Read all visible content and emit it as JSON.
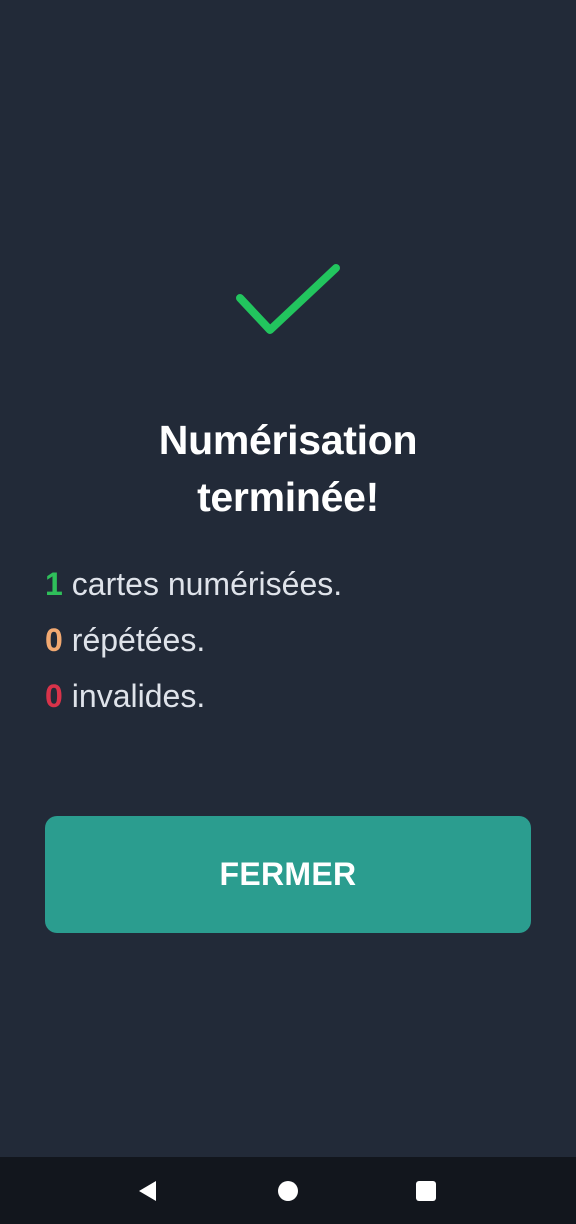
{
  "dialog": {
    "title": "Numérisation\nterminée!",
    "stats": [
      {
        "count": "1",
        "label": "cartes numérisées.",
        "color": "#2fbf5a"
      },
      {
        "count": "0",
        "label": "répétées.",
        "color": "#f2a971"
      },
      {
        "count": "0",
        "label": "invalides.",
        "color": "#d8334a"
      }
    ],
    "close_label": "FERMER"
  },
  "colors": {
    "background": "#222a38",
    "check": "#22c55e",
    "button": "#2b9d8f",
    "nav_bar": "#12161d"
  },
  "icons": {
    "status": "checkmark-icon",
    "nav_back": "back-triangle-icon",
    "nav_home": "home-circle-icon",
    "nav_recent": "recents-square-icon"
  }
}
